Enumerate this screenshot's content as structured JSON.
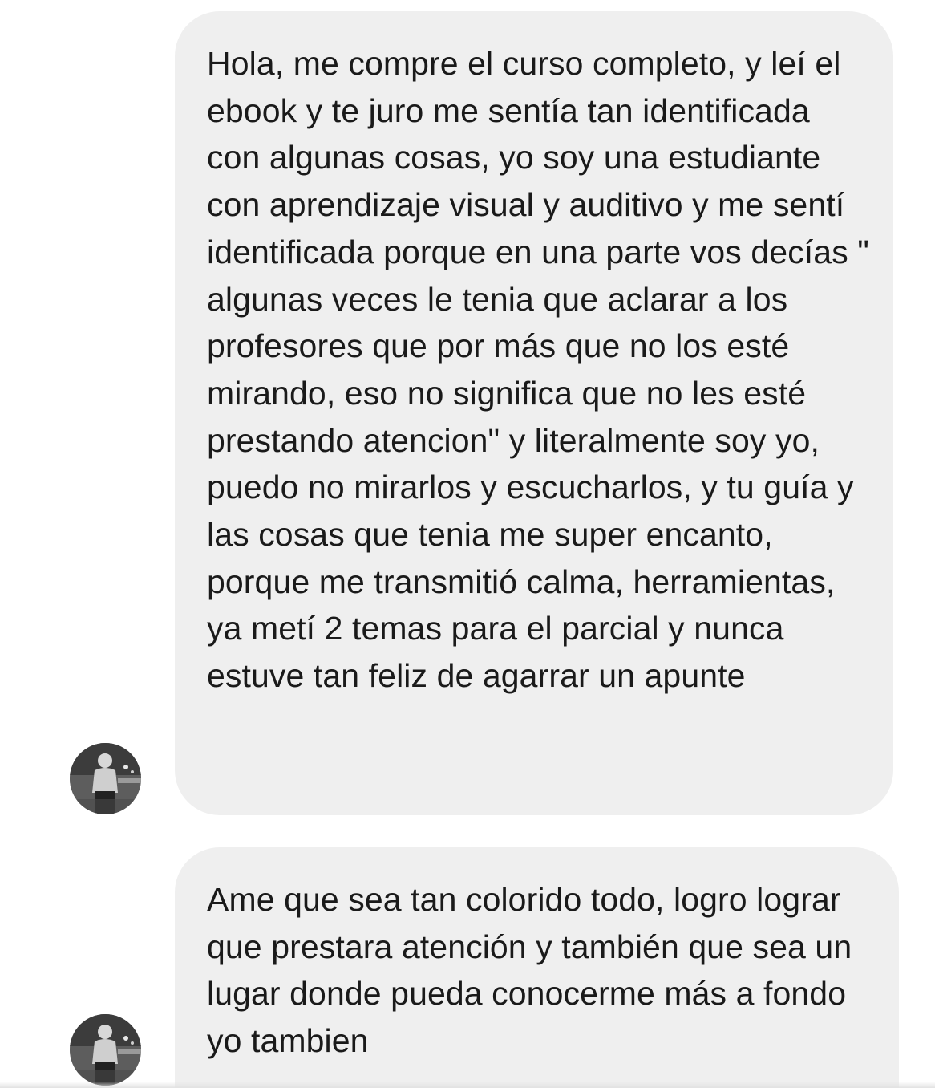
{
  "thread": {
    "messages": [
      {
        "sender": "incoming",
        "avatar_icon": "user-avatar-photo",
        "text": "Hola, me compre el curso completo, y leí el ebook y te juro me sentía tan identificada con algunas cosas, yo soy una estudiante con aprendizaje visual y auditivo y me sentí identificada porque en una parte vos decías \" algunas veces le tenia que aclarar a los profesores que por más que no los esté mirando, eso no significa que no les esté prestando atencion\" y literalmente soy yo, puedo no mirarlos y escucharlos, y tu guía y las cosas que tenia me super encanto, porque me transmitió calma, herramientas, ya metí 2 temas para el parcial y nunca estuve tan feliz de agarrar un apunte"
      },
      {
        "sender": "incoming",
        "avatar_icon": "user-avatar-photo",
        "text": "Ame que sea tan colorido todo, logro lograr que prestara atención y también que sea un lugar donde pueda conocerme más a fondo yo tambien"
      }
    ]
  },
  "colors": {
    "bubble_background": "#efefef",
    "text": "#1a1a1a",
    "page_background": "#ffffff"
  }
}
